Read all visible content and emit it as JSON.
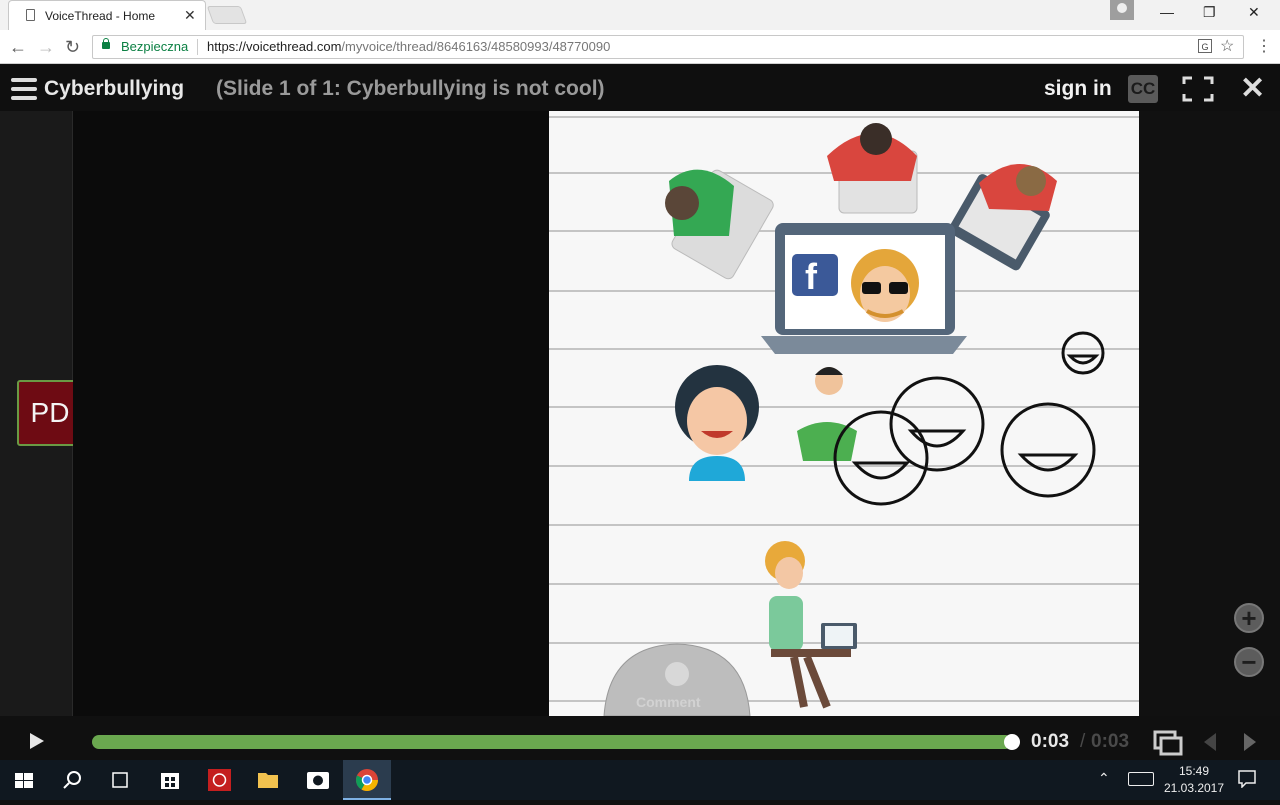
{
  "browser": {
    "tab_title": "VoiceThread - Home",
    "secure_label": "Bezpieczna",
    "url_host": "https://voicethread.com",
    "url_path": "/myvoice/thread/8646163/48580993/48770090"
  },
  "voicethread": {
    "title": "Cyberbullying",
    "slide_info": "(Slide 1 of 1: Cyberbullying is not cool)",
    "sign_in": "sign in",
    "cc_label": "CC",
    "avatar_initials": "PD",
    "comment_label": "Comment"
  },
  "player": {
    "current_time": "0:03",
    "separator": "/",
    "total_time": "0:03",
    "progress": 1.0
  },
  "taskbar": {
    "time": "15:49",
    "date": "21.03.2017"
  },
  "colors": {
    "progress": "#6aa84f",
    "avatar_bg": "#6e0b13",
    "secure_green": "#0b8043"
  }
}
